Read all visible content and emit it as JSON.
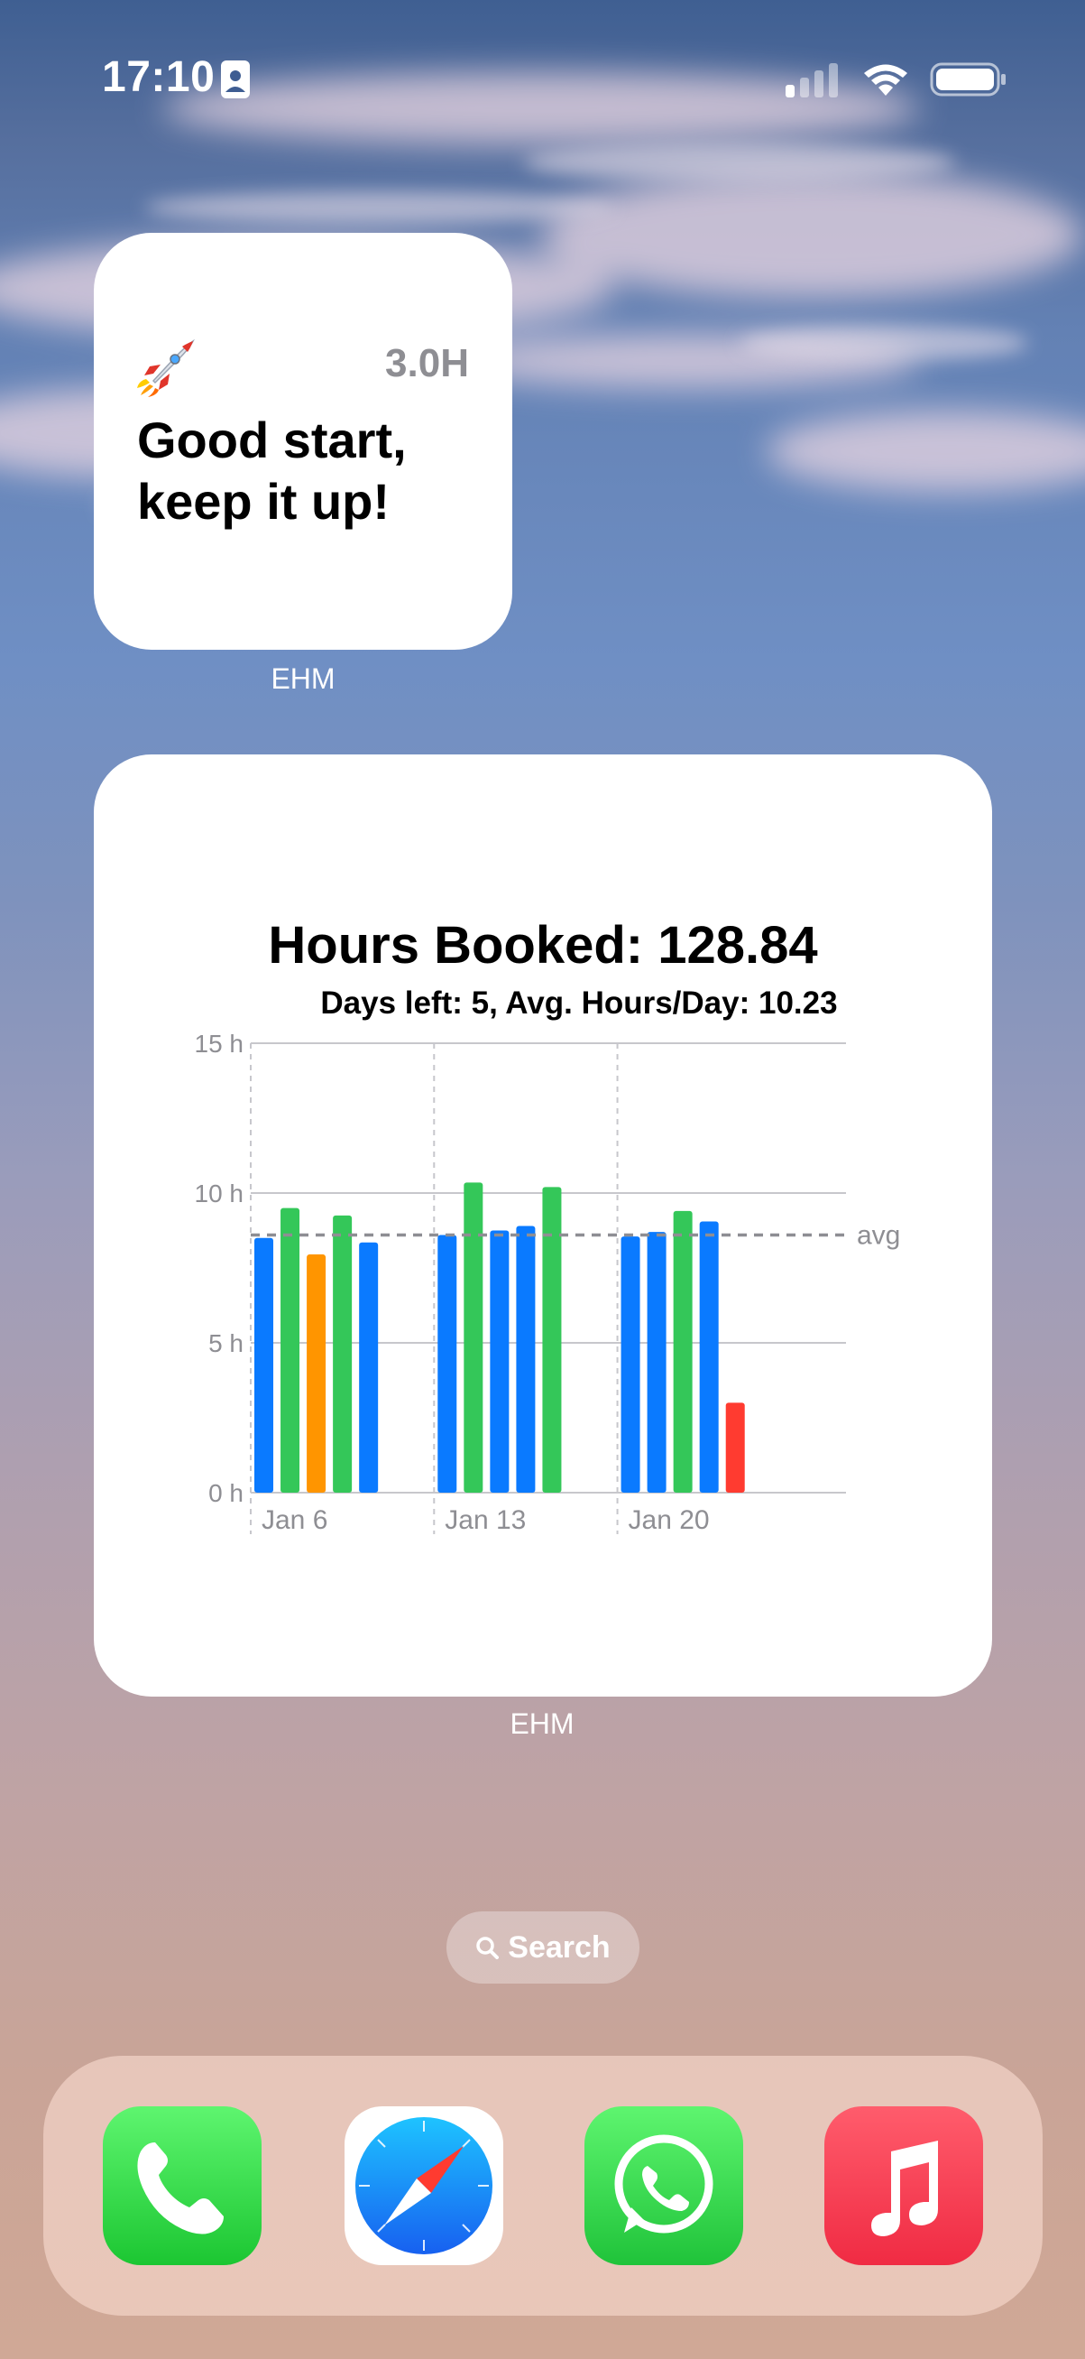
{
  "status_bar": {
    "time": "17:10",
    "icons": [
      "contact-card-icon",
      "cellular-signal-icon",
      "wifi-icon",
      "battery-icon"
    ]
  },
  "widget_small": {
    "emoji_icon": "rocket-icon",
    "hours": "3.0H",
    "message": "Good start, keep it up!",
    "app_label": "EHM"
  },
  "widget_chart": {
    "app_label": "EHM",
    "title": "Hours Booked: 128.84",
    "subtitle": "Days left: 5, Avg. Hours/Day: 10.23"
  },
  "chart_data": {
    "type": "bar",
    "x_tick_labels": [
      "Jan 6",
      "Jan 13",
      "Jan 20"
    ],
    "y_tick_labels": [
      "0 h",
      "5 h",
      "10 h",
      "15 h"
    ],
    "ylim": [
      0,
      15
    ],
    "avg_label": "avg",
    "avg_value": 8.6,
    "grid": true,
    "bars": [
      {
        "date": "Jan 6",
        "value": 8.5,
        "color": "#0a7aff"
      },
      {
        "date": "Jan 7",
        "value": 9.5,
        "color": "#34c759"
      },
      {
        "date": "Jan 8",
        "value": 7.95,
        "color": "#ff9500"
      },
      {
        "date": "Jan 9",
        "value": 9.25,
        "color": "#34c759"
      },
      {
        "date": "Jan 10",
        "value": 8.35,
        "color": "#0a7aff"
      },
      {
        "date": "Jan 13",
        "value": 8.6,
        "color": "#0a7aff"
      },
      {
        "date": "Jan 14",
        "value": 10.35,
        "color": "#34c759"
      },
      {
        "date": "Jan 15",
        "value": 8.75,
        "color": "#0a7aff"
      },
      {
        "date": "Jan 16",
        "value": 8.9,
        "color": "#0a7aff"
      },
      {
        "date": "Jan 17",
        "value": 10.2,
        "color": "#34c759"
      },
      {
        "date": "Jan 20",
        "value": 8.55,
        "color": "#0a7aff"
      },
      {
        "date": "Jan 21",
        "value": 8.7,
        "color": "#0a7aff"
      },
      {
        "date": "Jan 22",
        "value": 9.4,
        "color": "#34c759"
      },
      {
        "date": "Jan 23",
        "value": 9.05,
        "color": "#0a7aff"
      },
      {
        "date": "Jan 24",
        "value": 3.0,
        "color": "#ff3b30"
      }
    ]
  },
  "search": {
    "label": "Search",
    "icon": "search-icon"
  },
  "dock": {
    "apps": [
      {
        "name": "Phone",
        "icon": "phone-icon",
        "color": "#34c759"
      },
      {
        "name": "Safari",
        "icon": "safari-compass-icon",
        "color": "#1f8cff"
      },
      {
        "name": "WhatsApp",
        "icon": "whatsapp-icon",
        "color": "#25d366"
      },
      {
        "name": "Music",
        "icon": "music-note-icon",
        "color": "#fc3c44"
      }
    ]
  }
}
